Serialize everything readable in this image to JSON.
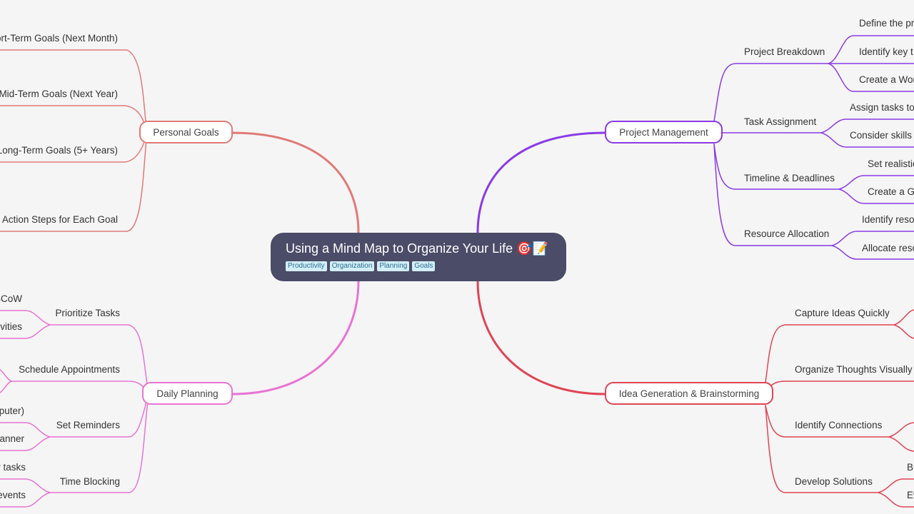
{
  "root": {
    "title": "Using a Mind Map to Organize Your Life 🎯📝",
    "tags": [
      "Productivity",
      "Organization",
      "Planning",
      "Goals"
    ]
  },
  "colors": {
    "background": "#f5f5f5",
    "root_bg": "#4b4c68",
    "tag_bg": "#d2eef8",
    "tag_text": "#2d6f8e",
    "personal_goals": "#e07a78",
    "daily_planning": "#e874d2",
    "project_management": "#8a3be6",
    "idea_generation": "#e04454"
  },
  "branches": {
    "personal_goals": {
      "label": "Personal Goals",
      "children": [
        "Short-Term Goals (Next Month)",
        "Mid-Term Goals (Next Year)",
        "Long-Term Goals (5+ Years)",
        "Action Steps for Each Goal"
      ]
    },
    "daily_planning": {
      "label": "Daily Planning",
      "children": [
        {
          "label": "Prioritize Tasks",
          "children": [
            "SCoW",
            "vities"
          ]
        },
        {
          "label": "Schedule Appointments",
          "children": []
        },
        {
          "label": "Set Reminders",
          "children": [
            "puter)",
            "anner"
          ]
        },
        {
          "label": "Time Blocking",
          "children": [
            "r tasks",
            "events"
          ]
        }
      ]
    },
    "project_management": {
      "label": "Project Management",
      "children": [
        {
          "label": "Project Breakdown",
          "children": [
            "Define the pr",
            "Identify key t",
            "Create a Wor"
          ]
        },
        {
          "label": "Task Assignment",
          "children": [
            "Assign tasks to",
            "Consider skills"
          ]
        },
        {
          "label": "Timeline & Deadlines",
          "children": [
            "Set realistic",
            "Create a Ga"
          ]
        },
        {
          "label": "Resource Allocation",
          "children": [
            "Identify reso",
            "Allocate reso"
          ]
        }
      ]
    },
    "idea_generation": {
      "label": "Idea Generation & Brainstorming",
      "children": [
        {
          "label": "Capture Ideas Quickly",
          "children": []
        },
        {
          "label": "Organize Thoughts Visually",
          "children": []
        },
        {
          "label": "Identify Connections",
          "children": []
        },
        {
          "label": "Develop Solutions",
          "children": [
            "Br",
            "Ev"
          ]
        }
      ]
    }
  }
}
